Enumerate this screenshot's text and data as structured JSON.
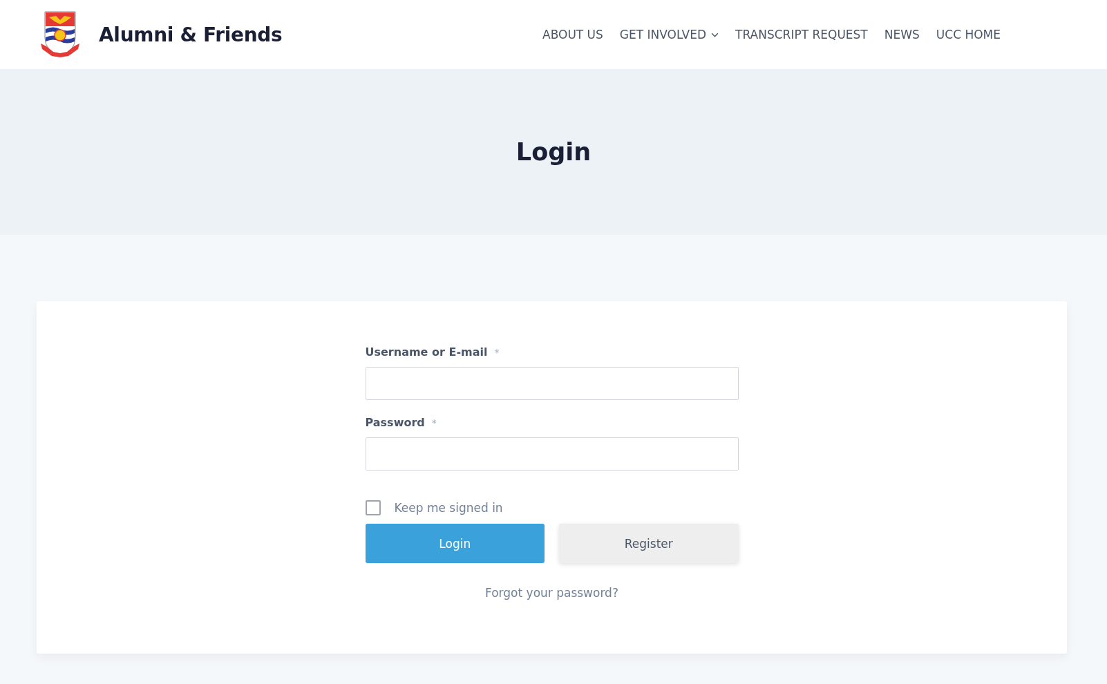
{
  "header": {
    "site_title": "Alumni & Friends",
    "nav": [
      {
        "label": "ABOUT US",
        "dropdown": false
      },
      {
        "label": "GET INVOLVED",
        "dropdown": true
      },
      {
        "label": "TRANSCRIPT REQUEST",
        "dropdown": false
      },
      {
        "label": "NEWS",
        "dropdown": false
      },
      {
        "label": "UCC HOME",
        "dropdown": false
      }
    ]
  },
  "hero": {
    "title": "Login"
  },
  "form": {
    "fields": [
      {
        "label": "Username or E-mail",
        "required_mark": "*"
      },
      {
        "label": "Password",
        "required_mark": "*"
      }
    ],
    "remember": {
      "label": "Keep me signed in",
      "checked": false
    },
    "buttons": [
      {
        "label": "Login",
        "kind": "primary"
      },
      {
        "label": "Register",
        "kind": "secondary"
      }
    ],
    "forgot_link": "Forgot your password?"
  }
}
